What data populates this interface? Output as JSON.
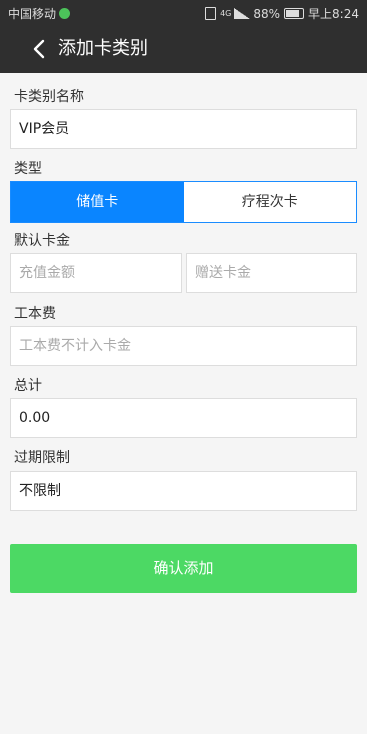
{
  "status_bar": {
    "carrier": "中国移动",
    "network": "4G",
    "battery": "88%",
    "time": "早上8:24"
  },
  "nav": {
    "title": "添加卡类别"
  },
  "form": {
    "card_name_label": "卡类别名称",
    "card_name_value": "VIP会员",
    "type_label": "类型",
    "type_options": [
      "储值卡",
      "疗程次卡"
    ],
    "type_selected": "储值卡",
    "default_amount_label": "默认卡金",
    "recharge_placeholder": "充值金额",
    "bonus_placeholder": "赠送卡金",
    "labor_fee_label": "工本费",
    "labor_fee_placeholder": "工本费不计入卡金",
    "total_label": "总计",
    "total_value": "0.00",
    "expiry_label": "过期限制",
    "expiry_value": "不限制"
  },
  "actions": {
    "confirm_label": "确认添加"
  },
  "colors": {
    "header_bg": "#2f2f2f",
    "segment_active": "#0a85ff",
    "confirm_bg": "#4cd964"
  }
}
